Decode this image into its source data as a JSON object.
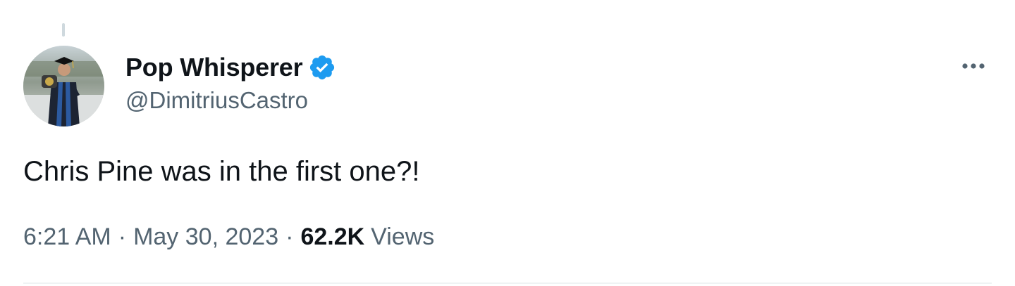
{
  "author": {
    "display_name": "Pop Whisperer",
    "handle": "@DimitriusCastro",
    "verified": true,
    "avatar_icon": "graduate-avatar"
  },
  "tweet": {
    "text": "Chris Pine was in the first one?!",
    "time": "6:21 AM",
    "separator": "·",
    "date": "May 30, 2023",
    "views_count": "62.2K",
    "views_label": "Views"
  },
  "actions": {
    "more_icon": "more-horizontal-icon"
  },
  "colors": {
    "primary_text": "#0f1419",
    "secondary_text": "#536471",
    "verified_blue": "#1d9bf0",
    "divider": "#eff3f4"
  }
}
